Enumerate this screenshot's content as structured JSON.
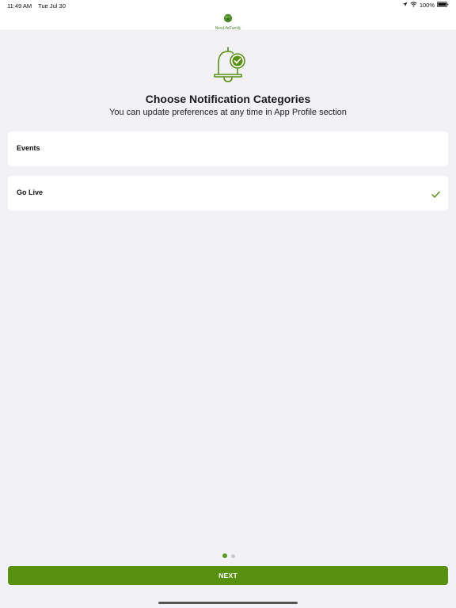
{
  "status_bar": {
    "time": "11:49 AM",
    "date": "Tue Jul 30",
    "battery": "100%",
    "icons": [
      "location-arrow-icon",
      "wifi-icon",
      "battery-icon"
    ]
  },
  "header": {
    "logo_text": "NewLifeFamily",
    "logo_icon": "tree-logo-icon"
  },
  "main": {
    "hero_icon": "bell-check-icon",
    "title": "Choose Notification Categories",
    "subtitle": "You can update preferences at any time in App Profile section",
    "categories": [
      {
        "label": "Events",
        "selected": false
      },
      {
        "label": "Go Live",
        "selected": true
      }
    ]
  },
  "pager": {
    "current_page": 1,
    "total_pages": 2
  },
  "footer": {
    "next_label": "NEXT"
  },
  "colors": {
    "accent": "#57910f",
    "background": "#f2f2f6",
    "card": "#ffffff"
  }
}
